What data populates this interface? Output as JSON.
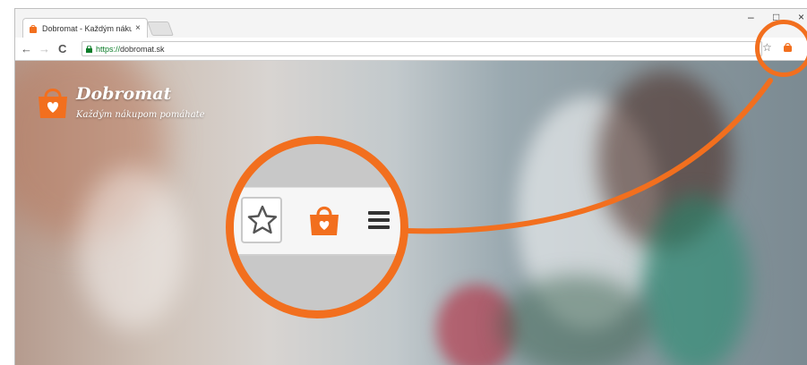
{
  "browser": {
    "tab_title": "Dobromat - Každým náku",
    "tab_close": "×",
    "url_scheme": "https://",
    "url_host": "dobromat.sk",
    "back": "←",
    "forward": "→",
    "reload": "C",
    "bookmark_star": "☆",
    "minimize": "–",
    "maximize": "□",
    "close": "×"
  },
  "page": {
    "brand_name": "Dobromat",
    "tagline": "Každým nákupom pomáhate"
  },
  "colors": {
    "accent": "#f26f1e",
    "bag": "#f26f1e"
  },
  "icons": {
    "extension": "shopping-bag-heart-icon",
    "bookmark": "star-icon",
    "menu": "hamburger-menu-icon"
  }
}
